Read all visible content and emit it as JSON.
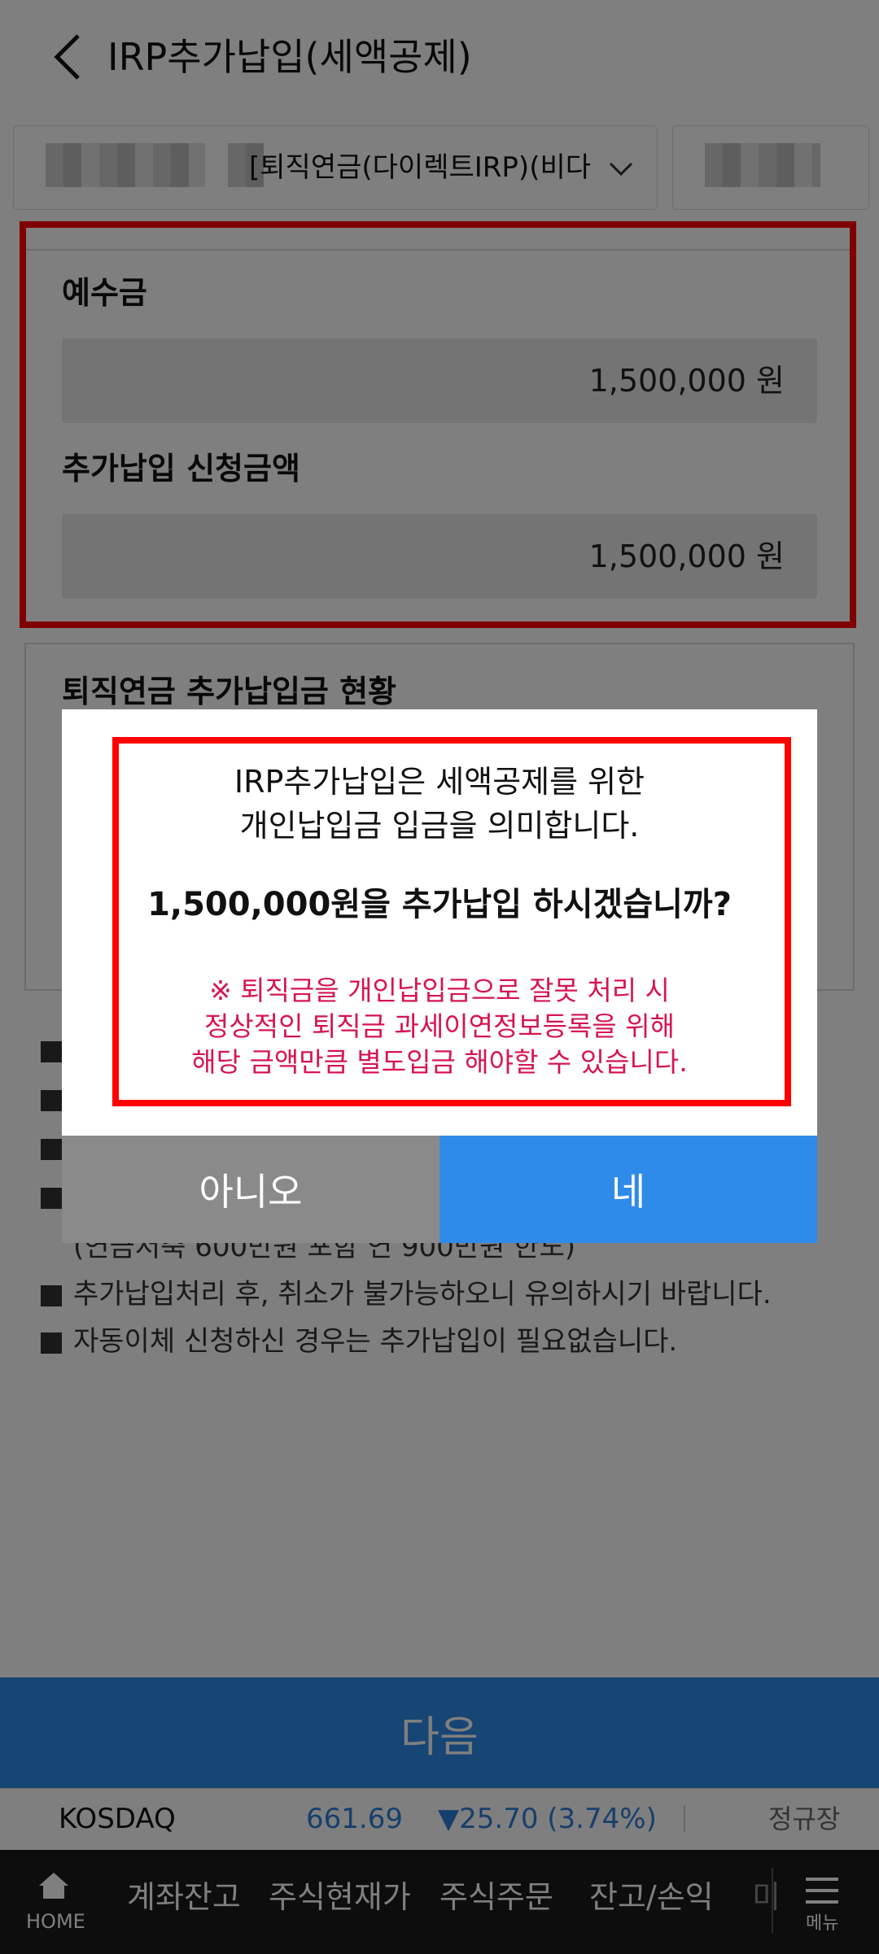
{
  "header": {
    "title": "IRP추가납입(세액공제)"
  },
  "account": {
    "selected_text": "[퇴직연금(다이렉트IRP)(비다"
  },
  "form": {
    "deposit_label": "예수금",
    "deposit_value": "1,500,000 원",
    "request_label": "추가납입 신청금액",
    "request_value": "1,500,000 원"
  },
  "status": {
    "title": "퇴직연금 추가납입금 현황"
  },
  "notes": [
    "(연금저축 600만원 포함 연 900만원 한도)",
    "추가납입처리 후, 취소가 불가능하오니 유의하시기 바랍니다.",
    "자동이체 신청하신 경우는 추가납입이 필요없습니다."
  ],
  "next_button": "다음",
  "ticker": {
    "name": "KOSDAQ",
    "value": "661.69",
    "change": "▼25.70 (3.74%)",
    "session": "정규장",
    "colors": {
      "value": "#2f7fd8",
      "change": "#2f7fd8"
    }
  },
  "bottom_nav": {
    "home": "HOME",
    "items": [
      "계좌잔고",
      "주식현재가",
      "주식주문",
      "잔고/손익",
      "미"
    ],
    "menu": "메뉴"
  },
  "dialog": {
    "line1": "IRP추가납입은 세액공제를 위한",
    "line2": "개인납입금 입금을 의미합니다.",
    "question": "1,500,000원을 추가납입 하시겠습니까?",
    "warning1": "※ 퇴직금을 개인납입금으로 잘못 처리 시",
    "warning2": "정상적인 퇴직금 과세이연정보등록을 위해",
    "warning3": "해당 금액만큼 별도입금 해야할 수 있습니다.",
    "no": "아니오",
    "yes": "네"
  }
}
